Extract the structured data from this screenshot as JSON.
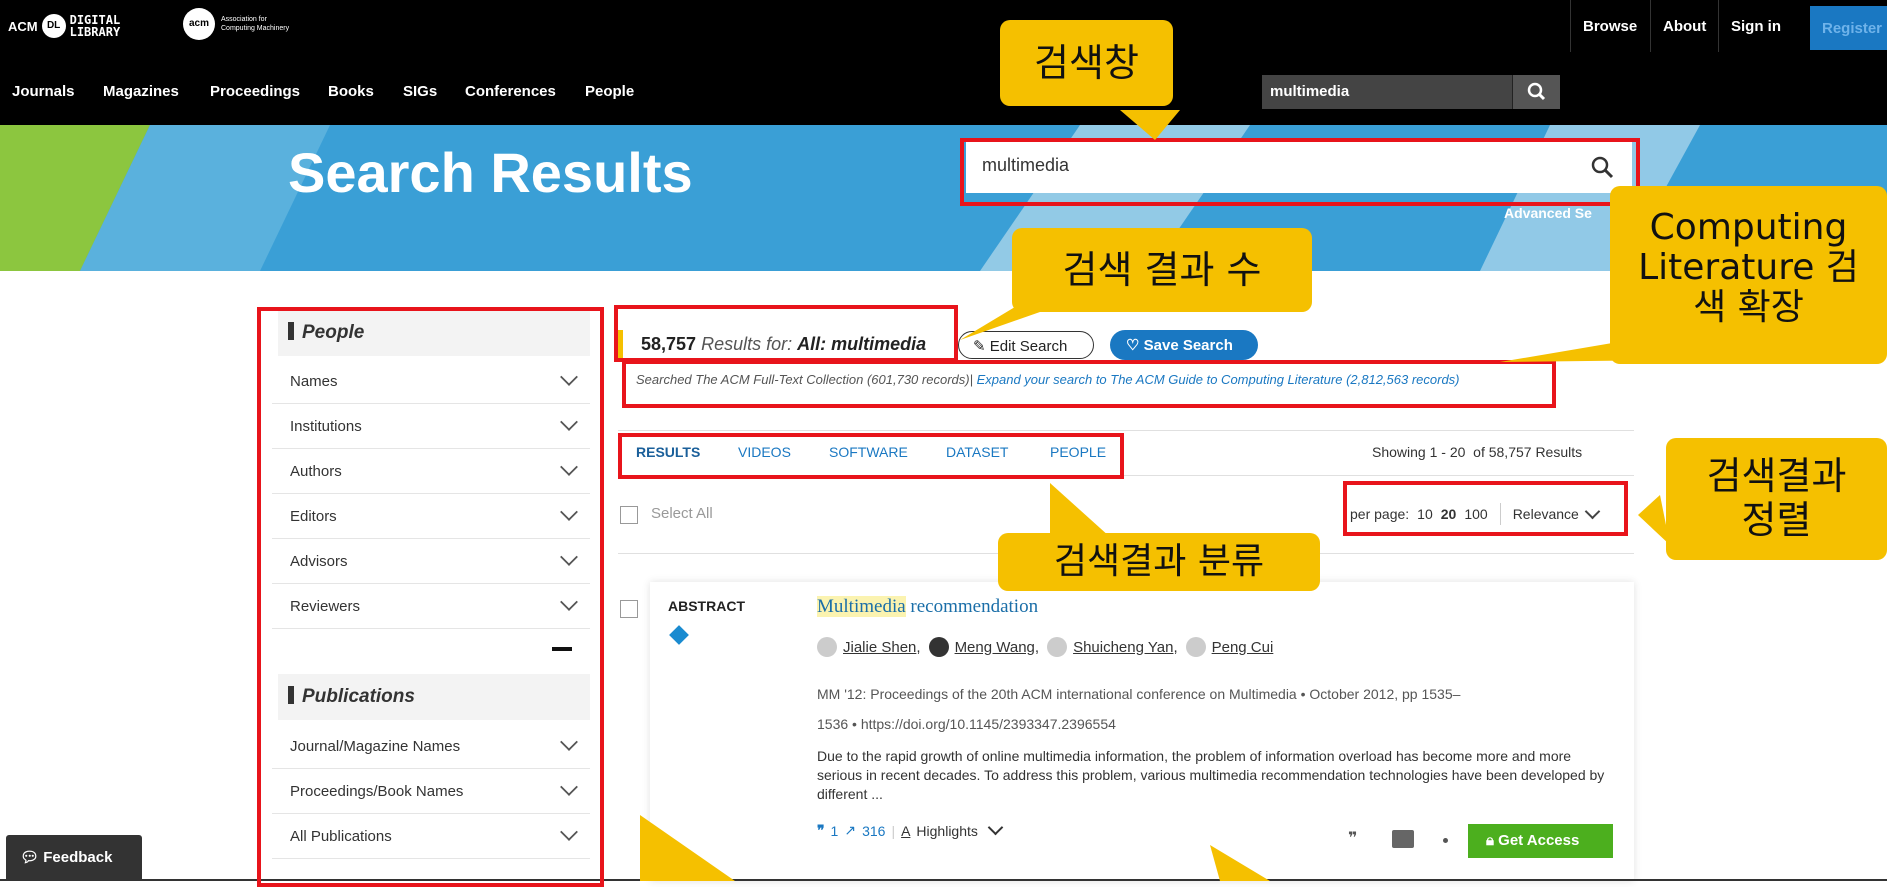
{
  "topbar": {
    "logo_acm": "ACM",
    "logo_dl_line1": "DIGITAL",
    "logo_dl_line2": "LIBRARY",
    "logo_acm2_line1": "Association for",
    "logo_acm2_line2": "Computing Machinery",
    "links_right": [
      "Browse",
      "About",
      "Sign in",
      "Register"
    ],
    "nav": [
      "Journals",
      "Magazines",
      "Proceedings",
      "Books",
      "SIGs",
      "Conferences",
      "People"
    ],
    "search_value": "multimedia"
  },
  "hero": {
    "title": "Search Results",
    "search_value": "multimedia",
    "advanced": "Advanced Se"
  },
  "sidebar": {
    "people_heading": "People",
    "people_items": [
      "Names",
      "Institutions",
      "Authors",
      "Editors",
      "Advisors",
      "Reviewers"
    ],
    "publications_heading": "Publications",
    "publication_items": [
      "Journal/Magazine Names",
      "Proceedings/Book Names",
      "All Publications"
    ]
  },
  "results": {
    "count": "58,757",
    "results_for": "Results for:",
    "query": "All: multimedia",
    "edit_search": "Edit Search",
    "save_search": "Save Search",
    "searched_text": "Searched The ACM Full-Text Collection (601,730 records)|",
    "expand_text": "Expand your search to The ACM Guide to Computing Literature (2,812,563 records)",
    "tabs": [
      "RESULTS",
      "VIDEOS",
      "SOFTWARE",
      "DATASET",
      "PEOPLE"
    ],
    "showing": "Showing 1 - 20  of 58,757 Results",
    "select_all": "Select All",
    "per_page_label": "per page:",
    "per_page_options": [
      "10",
      "20",
      "100"
    ],
    "sort": "Relevance"
  },
  "item": {
    "type": "ABSTRACT",
    "title_highlight": "Multimedia",
    "title_rest": " recommendation",
    "authors": [
      "Jialie Shen",
      "Meng Wang",
      "Shuicheng Yan",
      "Peng Cui"
    ],
    "venue_line1": "MM '12: Proceedings of the 20th ACM international conference on Multimedia • October 2012, pp 1535–",
    "venue_line2": "1536 • https://doi.org/10.1145/2393347.2396554",
    "abstract": "Due to the rapid growth of online multimedia information, the problem of information overload has become more and more serious in recent decades. To address this problem, various multimedia recommendation technologies have been developed by different ...",
    "citations": "1",
    "downloads": "316",
    "highlights": "Highlights",
    "get_access": "Get Access"
  },
  "feedback": "Feedback",
  "callouts": {
    "search_box": "검색창",
    "result_count": "검색 결과 수",
    "expand": "Computing Literature 검색 확장",
    "sort": "검색결과 정렬",
    "categories": "검색결과 분류"
  },
  "colors": {
    "annotation_red": "#e8141b",
    "callout_yellow": "#f5c000",
    "acm_blue": "#1a78c2",
    "get_access_green": "#4caf1e"
  }
}
